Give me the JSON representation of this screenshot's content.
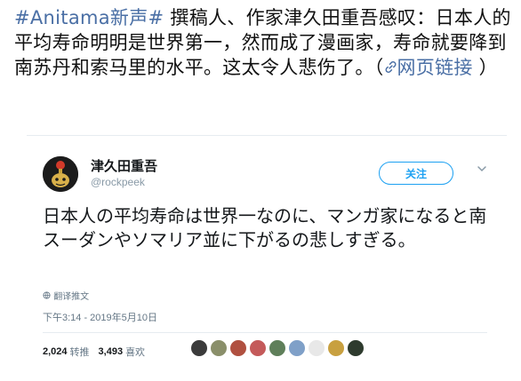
{
  "weibo": {
    "hashtag": "#Anitama新声#",
    "text_1": " 撰稿人、作家津久田重吾感叹：日本人的平均寿命明明是世界第一，然而成了漫画家，寿命就要降到南苏丹和索马里的水平。这太令人悲伤了。（",
    "link_icon": "🔗",
    "link_text": "网页链接",
    "text_2": " ）"
  },
  "tweet": {
    "author_name": "津久田重吾",
    "author_handle": "@rockpeek",
    "follow_label": "关注",
    "caret": "⌄",
    "body": "日本人の平均寿命は世界一なのに、マンガ家になると南スーダンやソマリア並に下がるの悲しすぎる。",
    "translate_label": "翻译推文",
    "timestamp": "下午3:14 - 2019年5月10日",
    "retweets_count": "2,024",
    "retweets_label": "转推",
    "likes_count": "3,493",
    "likes_label": "喜欢"
  },
  "icons": {
    "translate": "globe-icon",
    "link": "link-icon",
    "caret": "chevron-down-icon"
  },
  "colors": {
    "link_blue": "#4a6fa5",
    "twitter_blue": "#1da1f2",
    "muted": "#657786"
  },
  "liker_avatars": [
    "#3b3b3b",
    "#8a8f6a",
    "#b05040",
    "#c45a5a",
    "#5f7f5a",
    "#7fa0c8",
    "#e8e8e8",
    "#c8a040",
    "#2e3b2e"
  ]
}
